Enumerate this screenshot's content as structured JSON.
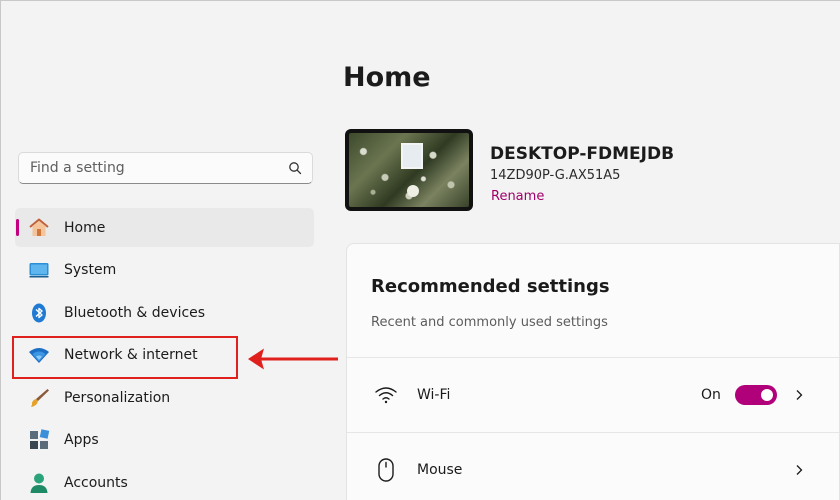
{
  "search": {
    "placeholder": "Find a setting",
    "icon": "search-icon"
  },
  "sidebar": {
    "items": [
      {
        "label": "Home",
        "icon": "home-icon",
        "active": true
      },
      {
        "label": "System",
        "icon": "monitor-icon"
      },
      {
        "label": "Bluetooth & devices",
        "icon": "bluetooth-icon"
      },
      {
        "label": "Network & internet",
        "icon": "wifi-icon"
      },
      {
        "label": "Personalization",
        "icon": "brush-icon"
      },
      {
        "label": "Apps",
        "icon": "apps-icon"
      },
      {
        "label": "Accounts",
        "icon": "person-icon"
      }
    ]
  },
  "main": {
    "title": "Home",
    "device": {
      "name": "DESKTOP-FDMEJDB",
      "model": "14ZD90P-G.AX51A5",
      "rename_label": "Rename"
    },
    "recommended": {
      "title": "Recommended settings",
      "subtitle": "Recent and commonly used settings",
      "rows": [
        {
          "label": "Wi-Fi",
          "state": "On",
          "toggle_on": true,
          "icon": "wifi-icon"
        },
        {
          "label": "Mouse",
          "icon": "mouse-icon"
        }
      ]
    }
  },
  "colors": {
    "accent": "#b0007a",
    "annotation": "#e0201c"
  }
}
